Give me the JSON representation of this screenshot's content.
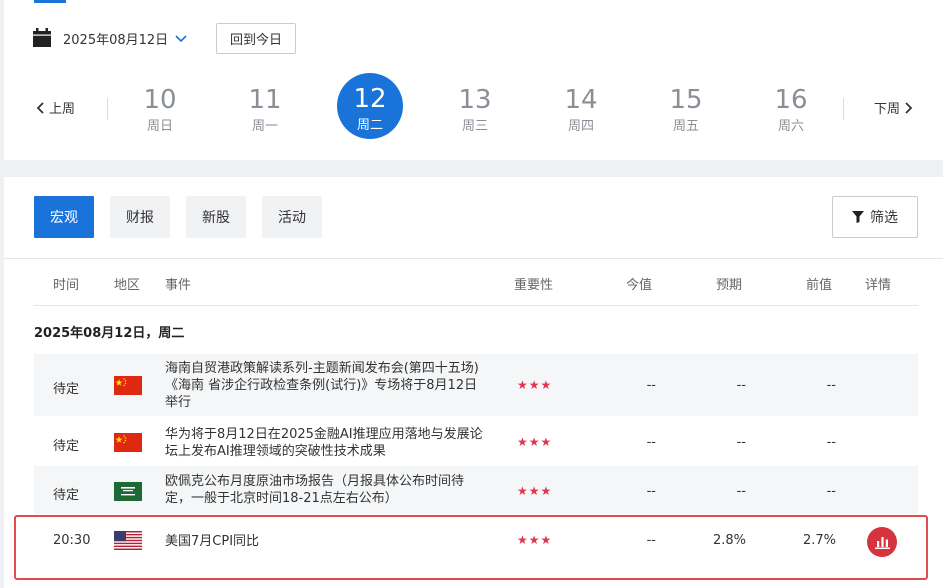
{
  "header": {
    "date_label": "2025年08月12日",
    "today_button": "回到今日",
    "prev_label": "上周",
    "next_label": "下周",
    "days": [
      {
        "num": "10",
        "weekday": "周日",
        "active": false
      },
      {
        "num": "11",
        "weekday": "周一",
        "active": false
      },
      {
        "num": "12",
        "weekday": "周二",
        "active": true
      },
      {
        "num": "13",
        "weekday": "周三",
        "active": false
      },
      {
        "num": "14",
        "weekday": "周四",
        "active": false
      },
      {
        "num": "15",
        "weekday": "周五",
        "active": false
      },
      {
        "num": "16",
        "weekday": "周六",
        "active": false
      }
    ]
  },
  "tabs": [
    {
      "label": "宏观",
      "active": true
    },
    {
      "label": "财报",
      "active": false
    },
    {
      "label": "新股",
      "active": false
    },
    {
      "label": "活动",
      "active": false
    }
  ],
  "filter_label": "筛选",
  "columns": {
    "time": "时间",
    "region": "地区",
    "event": "事件",
    "importance": "重要性",
    "actual": "今值",
    "forecast": "预期",
    "previous": "前值",
    "details": "详情"
  },
  "day_heading": "2025年08月12日，周二",
  "rows": [
    {
      "time": "待定",
      "region_icon": "china-flag-icon",
      "event": "海南自贸港政策解读系列-主题新闻发布会(第四十五场)《海南 省涉企行政检查条例(试行)》专场将于8月12日举行",
      "importance": "★★★",
      "actual": "--",
      "forecast": "--",
      "previous": "--"
    },
    {
      "time": "待定",
      "region_icon": "china-flag-icon",
      "event": "华为将于8月12日在2025金融AI推理应用落地与发展论坛上发布AI推理领域的突破性技术成果",
      "importance": "★★★",
      "actual": "--",
      "forecast": "--",
      "previous": "--"
    },
    {
      "time": "待定",
      "region_icon": "saudi-arabia-flag-icon",
      "event": "欧佩克公布月度原油市场报告（月报具体公布时间待定，一般于北京时间18-21点左右公布）",
      "importance": "★★★",
      "actual": "--",
      "forecast": "--",
      "previous": "--"
    },
    {
      "time": "20:30",
      "region_icon": "usa-flag-icon",
      "event": "美国7月CPI同比",
      "importance": "★★★",
      "actual": "--",
      "forecast": "2.8%",
      "previous": "2.7%",
      "details_icon": "bar-chart-icon"
    }
  ],
  "colors": {
    "accent": "#1a73d9",
    "star": "#e0364f",
    "highlight": "#e04b4f",
    "detail_button": "#d5333d"
  }
}
